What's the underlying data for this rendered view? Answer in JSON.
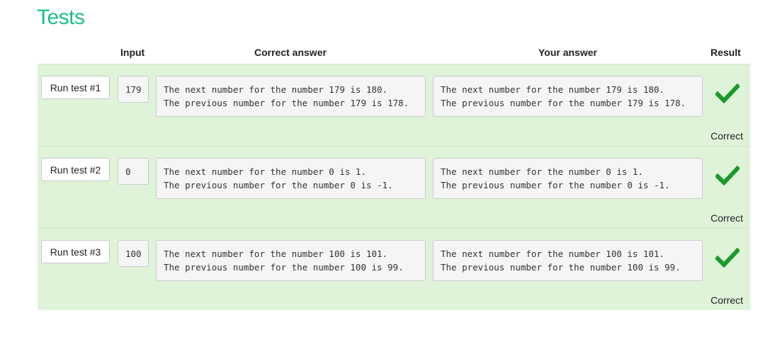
{
  "page": {
    "title": "Tests"
  },
  "table": {
    "headers": {
      "input": "Input",
      "correct": "Correct answer",
      "yours": "Your answer",
      "result": "Result"
    },
    "rows": [
      {
        "button_label": "Run test #1",
        "input": "179",
        "correct_answer": "The next number for the number 179 is 180.\nThe previous number for the number 179 is 178.",
        "your_answer": "The next number for the number 179 is 180.\nThe previous number for the number 179 is 178.",
        "result_icon": "checkmark-icon",
        "result": "Correct"
      },
      {
        "button_label": "Run test #2",
        "input": "0",
        "correct_answer": "The next number for the number 0 is 1.\nThe previous number for the number 0 is -1.",
        "your_answer": "The next number for the number 0 is 1.\nThe previous number for the number 0 is -1.",
        "result_icon": "checkmark-icon",
        "result": "Correct"
      },
      {
        "button_label": "Run test #3",
        "input": "100",
        "correct_answer": "The next number for the number 100 is 101.\nThe previous number for the number 100 is 99.",
        "your_answer": "The next number for the number 100 is 101.\nThe previous number for the number 100 is 99.",
        "result_icon": "checkmark-icon",
        "result": "Correct"
      }
    ]
  },
  "colors": {
    "title": "#1ec08a",
    "row_background": "#dff3d9",
    "check": "#1a9a2a"
  }
}
